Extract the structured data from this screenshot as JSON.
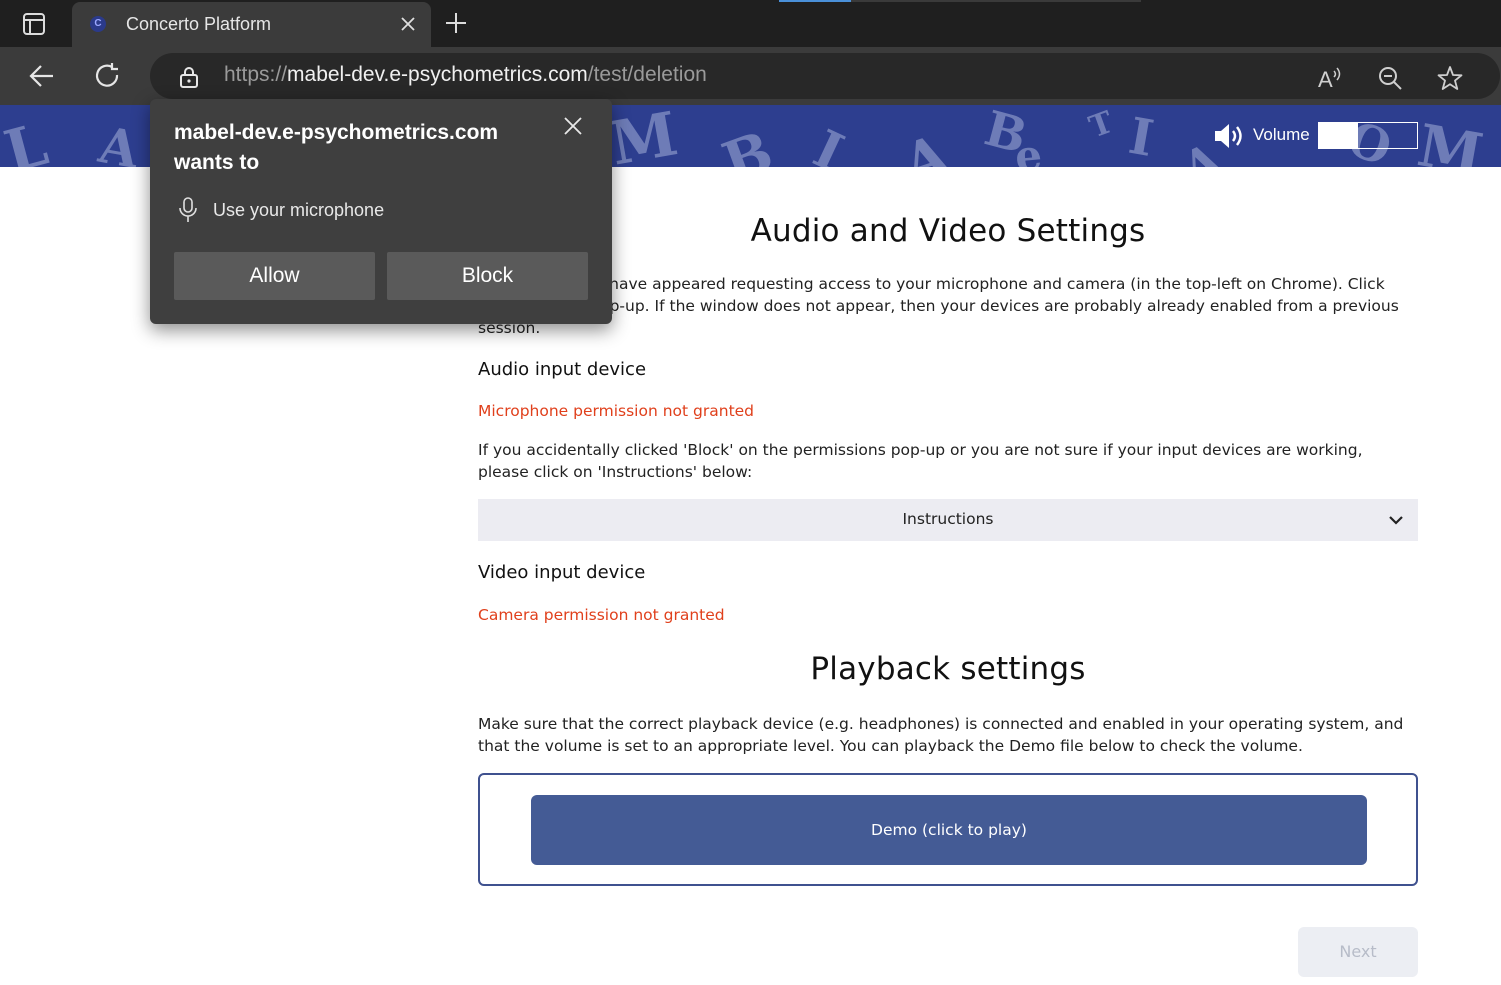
{
  "browser": {
    "tab_title": "Concerto Platform",
    "favicon_letter": "C",
    "url_scheme": "https://",
    "url_host": "mabel-dev.e-psychometrics.com",
    "url_path": "/test/deletion"
  },
  "permission_popup": {
    "title": "mabel-dev.e-psychometrics.com wants to",
    "request": "Use your microphone",
    "allow_label": "Allow",
    "block_label": "Block"
  },
  "banner": {
    "volume_label": "Volume",
    "volume_level": 0.4
  },
  "audio_video": {
    "title": "Audio and Video Settings",
    "intro": "A pop-up should have appeared requesting access to your microphone and camera (in the top-left on Chrome). Click 'Allow' on this pop-up. If the window does not appear, then your devices are probably already enabled from a previous session.",
    "audio_heading": "Audio input device",
    "audio_status": "Microphone permission not granted",
    "help_text": "If you accidentally clicked 'Block' on the permissions pop-up or you are not sure if your input devices are working, please click on 'Instructions' below:",
    "instructions_label": "Instructions",
    "video_heading": "Video input device",
    "video_status": "Camera permission not granted"
  },
  "playback": {
    "title": "Playback settings",
    "text": "Make sure that the correct playback device (e.g. headphones) is connected and enabled in your operating system, and that the volume is set to an appropriate level. You can playback the Demo file below to check the volume.",
    "demo_label": "Demo (click to play)",
    "next_label": "Next"
  },
  "colors": {
    "banner_bg": "#2d3e8f",
    "warning": "#e0401c",
    "demo_button": "#445b95"
  }
}
